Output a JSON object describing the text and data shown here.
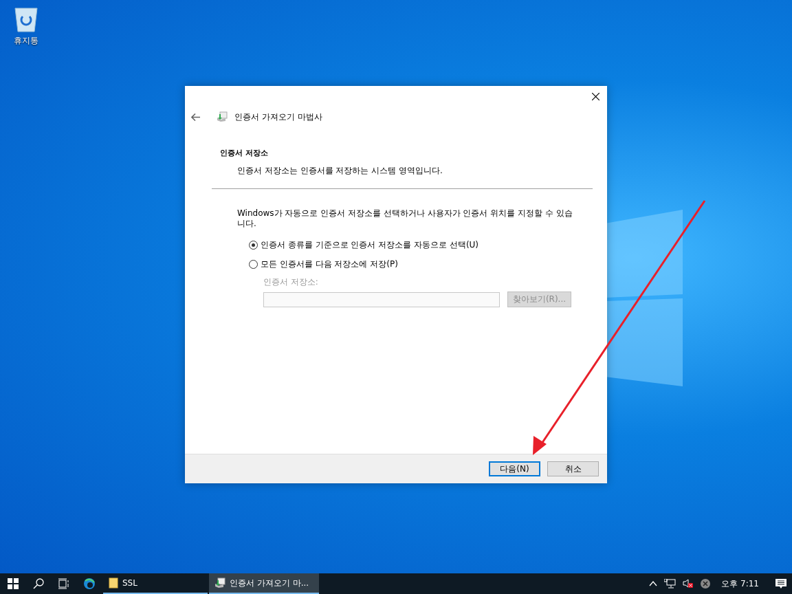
{
  "desktop_icons": [
    {
      "label": "휴지통"
    }
  ],
  "dialog": {
    "title": "인증서 가져오기 마법사",
    "section_title": "인증서 저장소",
    "section_description": "인증서 저장소는 인증서를 저장하는 시스템 영역입니다.",
    "body_text": "Windows가 자동으로 인증서 저장소를 선택하거나 사용자가 인증서 위치를 지정할 수 있습니다.",
    "options": [
      {
        "label": "인증서 종류를 기준으로 인증서 저장소를 자동으로 선택(U)",
        "selected": true
      },
      {
        "label": "모든 인증서를 다음 저장소에 저장(P)",
        "selected": false
      }
    ],
    "store_label": "인증서 저장소:",
    "browse_button": {
      "label": "찾아보기(R)...",
      "disabled": true
    },
    "buttons": [
      {
        "label": "다음(N)",
        "default": true
      },
      {
        "label": "취소",
        "default": false
      }
    ]
  },
  "taskbar": {
    "apps": [
      {
        "kind": "folder",
        "label": "SSL",
        "active": false
      },
      {
        "kind": "wizard",
        "label": "인증서 가져오기 마...",
        "active": true
      }
    ],
    "clock": "오후 7:11"
  }
}
